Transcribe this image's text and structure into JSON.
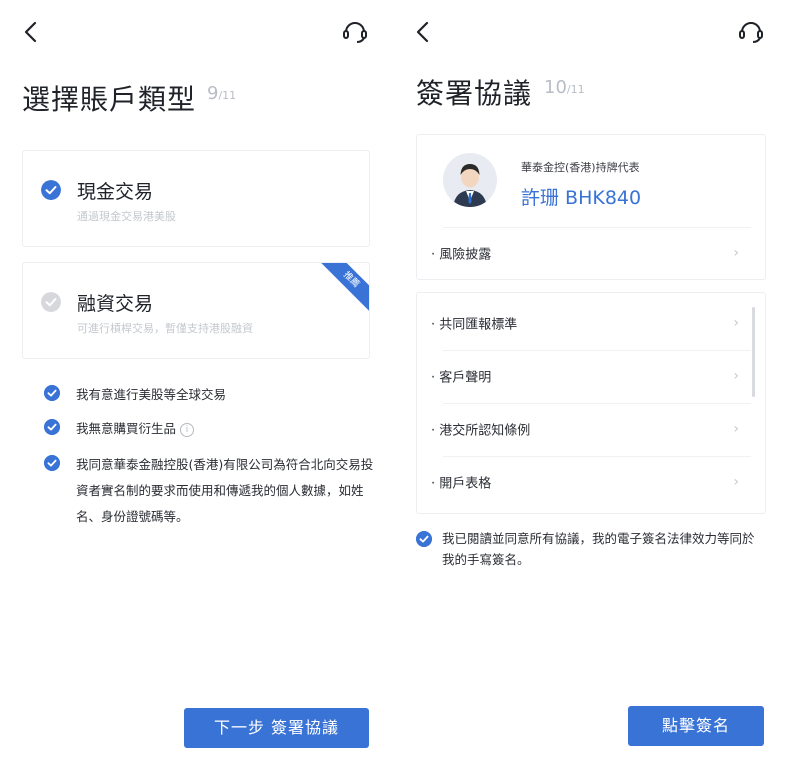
{
  "left": {
    "title": "選擇賬戶類型",
    "step_current": "9",
    "step_total": "/11",
    "options": [
      {
        "title": "現金交易",
        "subtitle": "通過現金交易港美股",
        "checked": true
      },
      {
        "title": "融資交易",
        "subtitle": "可進行槓桿交易，暫僅支持港股融資",
        "checked": false,
        "badge": "推薦"
      }
    ],
    "agreements": [
      "我有意進行美股等全球交易",
      "我無意購買衍生品",
      "我同意華泰金融控股(香港)有限公司為符合北向交易投資者實名制的要求而使用和傳遞我的個人數據，如姓名、身份證號碼等。"
    ],
    "next_button": "下一步 簽署協議"
  },
  "right": {
    "title": "簽署協議",
    "step_current": "10",
    "step_total": "/11",
    "rep_label": "華泰金控(香港)持牌代表",
    "rep_name": "許珊 BHK840",
    "risk_disclosure": "· 風險披露",
    "documents": [
      "· 共同匯報標準",
      "· 客戶聲明",
      "· 港交所認知條例",
      "· 開戶表格"
    ],
    "consent": "我已閱讀並同意所有協議，我的電子簽名法律效力等同於我的手寫簽名。",
    "sign_button": "點擊簽名"
  },
  "colors": {
    "accent": "#3a73d6",
    "muted": "#c4c8ce",
    "unchecked": "#d6d8dc"
  },
  "icons": {
    "back": "chevron-left-icon",
    "support": "headset-icon",
    "check": "check-circle-icon",
    "info": "info-icon",
    "arrow": "chevron-right-icon"
  }
}
